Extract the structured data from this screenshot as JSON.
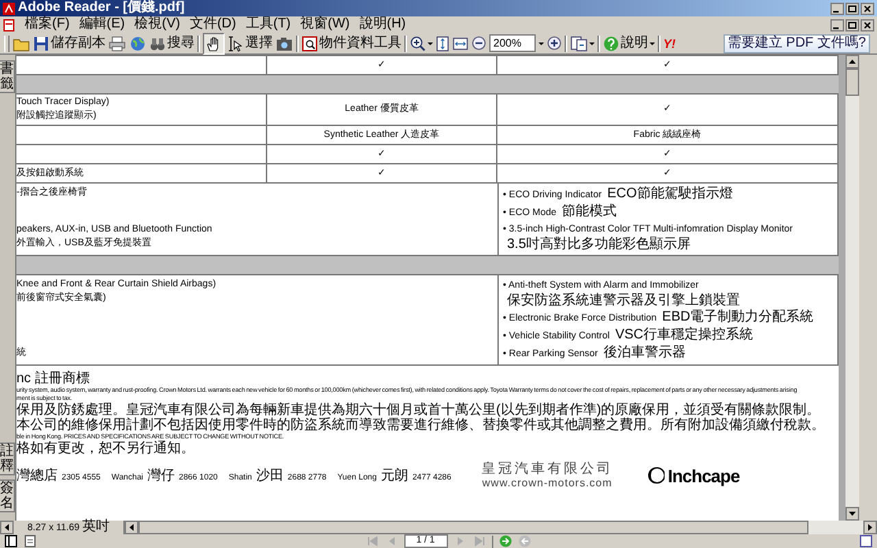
{
  "window": {
    "title": "Adobe Reader - [價錢.pdf]"
  },
  "menu": [
    "檔案(F)",
    "編輯(E)",
    "檢視(V)",
    "文件(D)",
    "工具(T)",
    "視窗(W)",
    "說明(H)"
  ],
  "toolbar": {
    "save_label": "儲存副本",
    "search_label": "搜尋",
    "hand_selected": true,
    "select_label": "選擇",
    "object_tool_label": "物件資料工具",
    "zoom": "200%",
    "help_label": "說明",
    "y_label": "Y!",
    "ad": "需要建立 PDF 文件嗎?"
  },
  "nav_tabs_top": [
    "書籤"
  ],
  "nav_tabs_bottom": [
    "註釋",
    "簽名"
  ],
  "table": {
    "rows": [
      {
        "kind": "row",
        "column_2": "✓",
        "column_3": "✓"
      },
      {
        "kind": "band"
      },
      {
        "kind": "row",
        "column_1": [
          "Touch Tracer Display)",
          "附設觸控追蹤顯示)"
        ],
        "column_2": "Leather 優質皮革",
        "column_3": "✓"
      },
      {
        "kind": "row",
        "column_2": "Synthetic Leather 人造皮革",
        "column_3": "Fabric 絨絨座椅"
      },
      {
        "kind": "row",
        "column_2": "✓",
        "column_3": "✓"
      },
      {
        "kind": "row",
        "column_1": [
          "及按鈕啟動系統"
        ],
        "column_2": "✓",
        "column_3": "✓"
      },
      {
        "kind": "list",
        "left": [
          {
            "lines": [
              "-摺合之後座椅背"
            ]
          },
          {
            "lines": [
              "peakers, AUX-in, USB and Bluetooth Function",
              "外置輸入，USB及藍牙免提裝置"
            ]
          }
        ],
        "right": [
          {
            "kind": "inline",
            "en": "• ECO Driving Indicator",
            "zh": "ECO節能駕駛指示燈"
          },
          {
            "kind": "inline",
            "en": "• ECO Mode",
            "zh": "節能模式"
          },
          {
            "kind": "stacked",
            "en": "• 3.5-inch High-Contrast Color TFT Multi-infomration Display Monitor",
            "zh": "3.5吋高對比多功能彩色顯示屏"
          }
        ]
      },
      {
        "kind": "band"
      },
      {
        "kind": "list",
        "left": [
          {
            "lines": [
              "Knee and Front & Rear Curtain Shield Airbags)",
              "前後窗帘式安全氣囊)"
            ]
          },
          {
            "lines": [
              "統"
            ]
          }
        ],
        "right": [
          {
            "kind": "stacked",
            "en": "• Anti-theft System with Alarm and Immobilizer",
            "zh": "保安防盜系統連警示器及引擎上鎖裝置"
          },
          {
            "kind": "inline",
            "en": "• Electronic Brake Force Distribution",
            "zh": "EBD電子制動力分配系統"
          },
          {
            "kind": "inline",
            "en": "• Vehicle Stability Control",
            "zh": "VSC行車穩定操控系統"
          },
          {
            "kind": "inline",
            "en": "• Rear Parking Sensor",
            "zh": "後泊車警示器"
          }
        ]
      }
    ]
  },
  "footnotes": [
    {
      "kind": "cjk",
      "text": "nc 註冊商標"
    },
    {
      "kind": "latin",
      "text": "urity system, audio system, warranty and rust-proofing. Crown Motors Ltd. warrants each new vehicle for 60 months or 100,000km (whichever comes first), with related conditions apply. Toyota Warranty terms do not cover the cost of repairs, replacement of parts or any other necessary adjustments arising"
    },
    {
      "kind": "latin",
      "text": "ment is subject to tax."
    },
    {
      "kind": "cjk",
      "text": "保用及防銹處理。皇冠汽車有限公司為每輛新車提供為期六十個月或首十萬公里(以先到期者作準)的原廠保用，並須受有關條款限制。本公司的維修保用計劃不包括因使用零件時的防盜系統而導致需要進行維修、替換零件或其他調整之費用。所有附加設備須繳付稅款。"
    },
    {
      "kind": "latin",
      "text": "ble in Hong Kong. PRICES AND SPECIFICATIONS ARE SUBJECT TO CHANGE WITHOUT NOTICE."
    },
    {
      "kind": "cjk",
      "text": "格如有更改，恕不另行通知。"
    }
  ],
  "footer": {
    "branches": [
      {
        "zh": "灣總店",
        "phone": "2305 4555"
      },
      {
        "name": "Wanchai",
        "zh": "灣仔",
        "phone": "2866 1020"
      },
      {
        "name": "Shatin",
        "zh": "沙田",
        "phone": "2688 2778"
      },
      {
        "name": "Yuen Long",
        "zh": "元朗",
        "phone": "2477 4286"
      }
    ],
    "company_zh": "皇冠汽車有限公司",
    "company_url": "www.crown-motors.com",
    "logo_text": "Inchcape"
  },
  "page_size": {
    "value": "8.27 x 11.69",
    "unit": "英吋"
  },
  "page_field": "1 / 1"
}
